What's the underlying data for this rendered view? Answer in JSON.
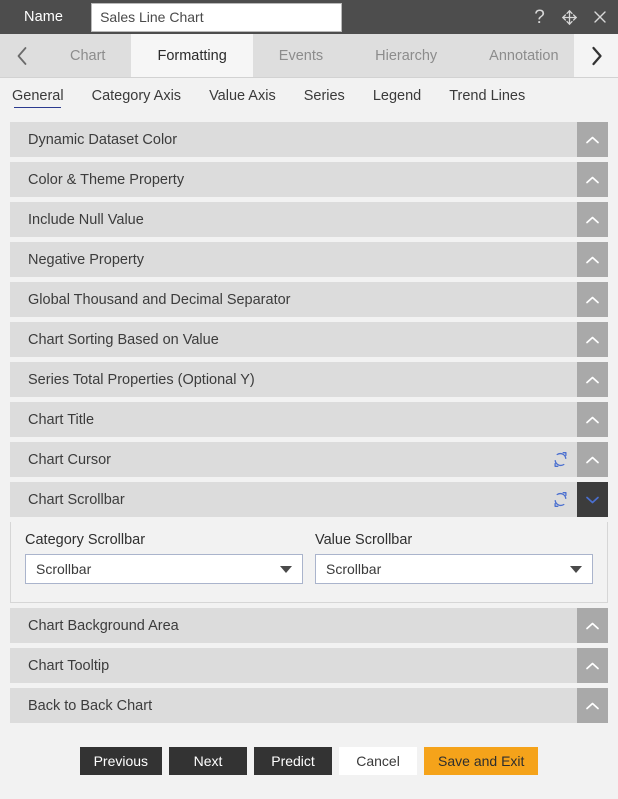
{
  "titlebar": {
    "name_label": "Name",
    "name_value": "Sales Line Chart",
    "name_placeholder": "Name",
    "help_icon": "question-mark-icon",
    "move_icon": "move-cross-icon",
    "close_icon": "close-icon"
  },
  "tabstrip": {
    "prev_icon": "chevron-left-icon",
    "next_icon": "chevron-right-icon",
    "tabs": [
      {
        "label": "Chart",
        "active": false
      },
      {
        "label": "Formatting",
        "active": true
      },
      {
        "label": "Events",
        "active": false
      },
      {
        "label": "Hierarchy",
        "active": false
      },
      {
        "label": "Annotation",
        "active": false
      }
    ]
  },
  "subtabs": [
    {
      "label": "General",
      "active": true
    },
    {
      "label": "Category Axis",
      "active": false
    },
    {
      "label": "Value Axis",
      "active": false
    },
    {
      "label": "Series",
      "active": false
    },
    {
      "label": "Legend",
      "active": false
    },
    {
      "label": "Trend Lines",
      "active": false
    }
  ],
  "sections": [
    {
      "label": "Dynamic Dataset Color",
      "expanded": false,
      "refresh": false
    },
    {
      "label": "Color & Theme Property",
      "expanded": false,
      "refresh": false
    },
    {
      "label": "Include Null Value",
      "expanded": false,
      "refresh": false
    },
    {
      "label": "Negative Property",
      "expanded": false,
      "refresh": false
    },
    {
      "label": "Global Thousand and Decimal Separator",
      "expanded": false,
      "refresh": false
    },
    {
      "label": "Chart Sorting Based on Value",
      "expanded": false,
      "refresh": false
    },
    {
      "label": "Series Total Properties (Optional Y)",
      "expanded": false,
      "refresh": false
    },
    {
      "label": "Chart Title",
      "expanded": false,
      "refresh": false
    },
    {
      "label": "Chart Cursor",
      "expanded": false,
      "refresh": true
    },
    {
      "label": "Chart Scrollbar",
      "expanded": true,
      "refresh": true
    },
    {
      "label": "Chart Background Area",
      "expanded": false,
      "refresh": false
    },
    {
      "label": "Chart Tooltip",
      "expanded": false,
      "refresh": false
    },
    {
      "label": "Back to Back Chart",
      "expanded": false,
      "refresh": false
    }
  ],
  "scrollbar_panel": {
    "category": {
      "label": "Category Scrollbar",
      "value": "Scrollbar"
    },
    "value": {
      "label": "Value Scrollbar",
      "value": "Scrollbar"
    }
  },
  "footer": {
    "buttons": [
      {
        "label": "Previous",
        "style": "dark"
      },
      {
        "label": "Next",
        "style": "dark"
      },
      {
        "label": "Predict",
        "style": "dark"
      },
      {
        "label": "Cancel",
        "style": "light"
      },
      {
        "label": "Save and Exit",
        "style": "accent"
      }
    ]
  },
  "colors": {
    "titlebar_bg": "#4d4d4d",
    "accent": "#f5a31a",
    "section_bg": "#dcdcdc",
    "toggle_bg": "#a9a9a9",
    "toggle_expanded_bg": "#3c3c3c",
    "refresh_icon": "#4a6fd0",
    "subtab_underline": "#2b3a8f"
  }
}
